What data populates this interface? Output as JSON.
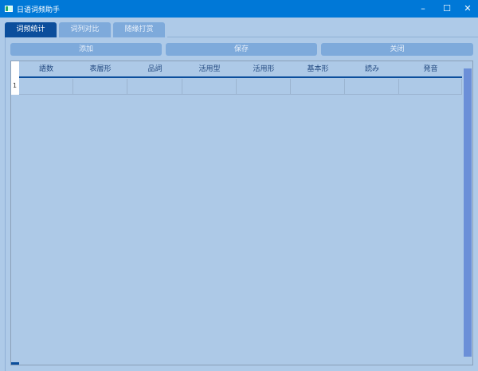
{
  "window": {
    "title": "日语词频助手"
  },
  "tabs": [
    {
      "label": "词频统计"
    },
    {
      "label": "词列对比"
    },
    {
      "label": "随缘打赏"
    }
  ],
  "toolbar": {
    "add": "添加",
    "save": "保存",
    "close": "关闭"
  },
  "table": {
    "columns": [
      "語数",
      "表層形",
      "品詞",
      "活用型",
      "活用形",
      "基本形",
      "読み",
      "発音"
    ],
    "rows": [
      {
        "index": "1"
      }
    ]
  }
}
